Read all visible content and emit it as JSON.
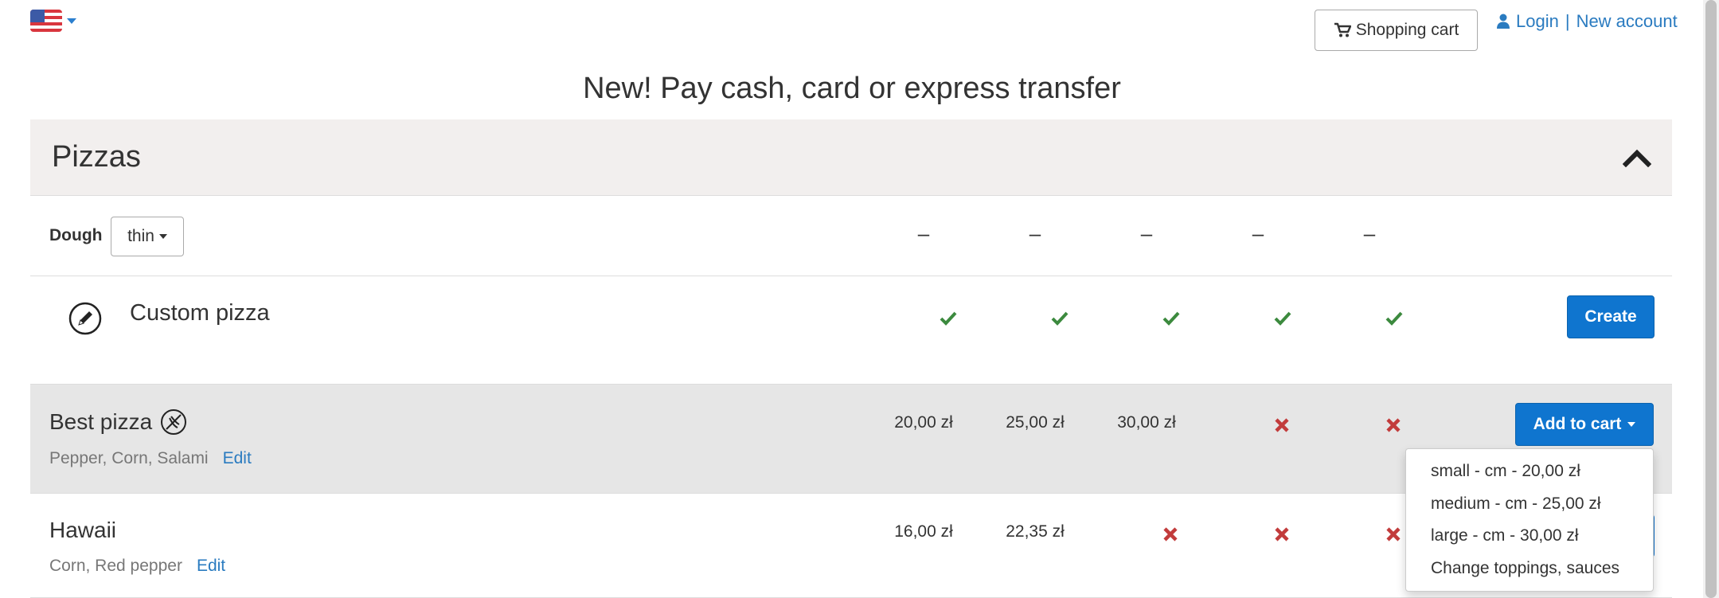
{
  "header": {
    "language_icon": "us-flag-icon",
    "shopping_cart_label": "Shopping cart",
    "login_label": "Login",
    "separator": "|",
    "new_account_label": "New account"
  },
  "banner": "New! Pay cash, card or express transfer",
  "panel": {
    "title": "Pizzas",
    "dough_label": "Dough",
    "dough_value": "thin",
    "size_columns": [
      "–",
      "–",
      "–",
      "–",
      "–"
    ],
    "custom": {
      "title": "Custom pizza",
      "create_label": "Create"
    },
    "pizzas": [
      {
        "name": "Best pizza",
        "toppings": "Pepper, Corn, Salami",
        "edit_label": "Edit",
        "prices": [
          "20,00 zł",
          "25,00 zł",
          "30,00 zł"
        ],
        "add_label": "Add to cart"
      },
      {
        "name": "Hawaii",
        "toppings": "Corn, Red pepper",
        "edit_label": "Edit",
        "prices": [
          "16,00 zł",
          "22,35 zł"
        ]
      }
    ]
  },
  "dropdown": [
    "small - cm - 20,00 zł",
    "medium - cm - 25,00 zł",
    "large - cm - 30,00 zł",
    "Change toppings, sauces"
  ],
  "colors": {
    "accent": "#0f75cf",
    "link": "#2a7bc0",
    "check": "#3c8a3e",
    "cross": "#c23b3b",
    "panel_bg": "#f2efee",
    "highlight_row": "#e6e6e6"
  }
}
